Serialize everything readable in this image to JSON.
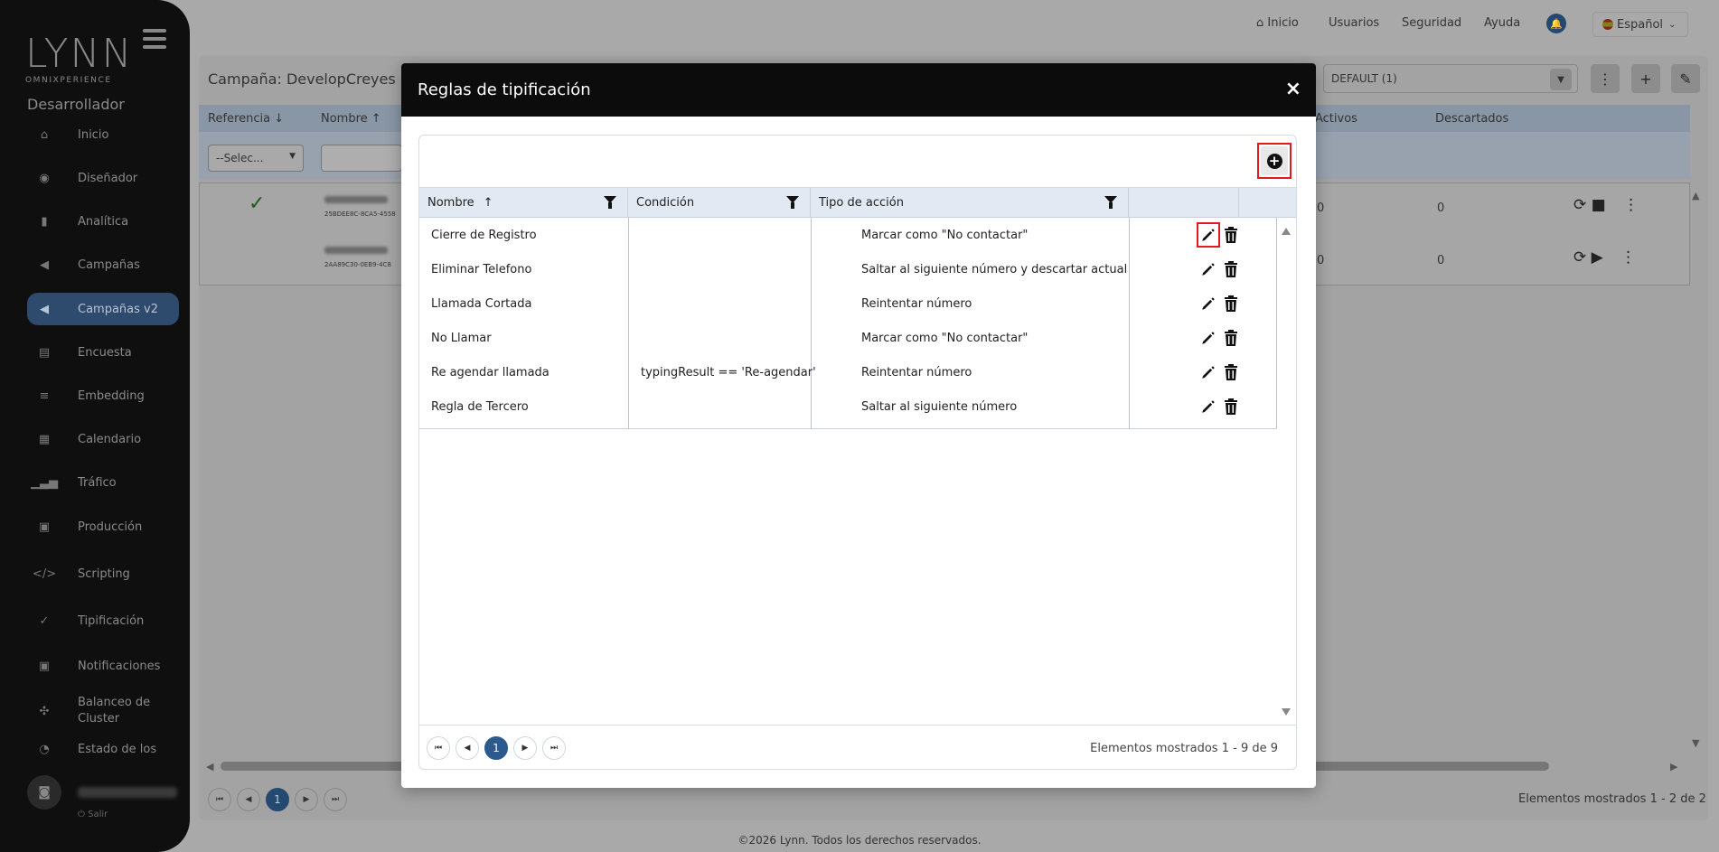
{
  "brand": {
    "logo_text": "LYNN",
    "logo_sub": "OMNIXPERIENCE"
  },
  "sidebar": {
    "role": "Desarrollador",
    "items": [
      {
        "label": "Inicio",
        "icon": "home-icon"
      },
      {
        "label": "Diseñador",
        "icon": "palette-icon"
      },
      {
        "label": "Analítica",
        "icon": "bar-chart-icon"
      },
      {
        "label": "Campañas",
        "icon": "megaphone-icon"
      },
      {
        "label": "Campañas v2",
        "icon": "megaphone-icon",
        "active": true
      },
      {
        "label": "Encuesta",
        "icon": "clipboard-icon"
      },
      {
        "label": "Embedding",
        "icon": "database-icon"
      },
      {
        "label": "Calendario",
        "icon": "calendar-icon"
      },
      {
        "label": "Tráfico",
        "icon": "signal-icon"
      },
      {
        "label": "Producción",
        "icon": "briefcase-icon"
      },
      {
        "label": "Scripting",
        "icon": "code-icon"
      },
      {
        "label": "Tipificación",
        "icon": "check-badge-icon"
      },
      {
        "label": "Notificaciones",
        "icon": "bell-square-icon"
      },
      {
        "label": "Balanceo de Cluster",
        "icon": "cluster-icon"
      },
      {
        "label": "Estado de los",
        "icon": "status-icon"
      }
    ],
    "logout": "Salir"
  },
  "topnav": {
    "home": "Inicio",
    "users": "Usuarios",
    "security": "Seguridad",
    "help": "Ayuda",
    "language": "Español"
  },
  "background": {
    "campaign_title": "Campaña: DevelopCreyes",
    "default_select": "DEFAULT (1)",
    "columns": [
      "Referencia",
      "Nombre",
      "Activos",
      "Descartados"
    ],
    "filter_select": "--Selec...",
    "rows": [
      {
        "id": "25BDEE8C-8CA5-4558",
        "activos": "0",
        "descartados": "0"
      },
      {
        "id": "2AA89C30-0EB9-4C8",
        "activos": "0",
        "descartados": "0"
      }
    ],
    "pager_current": "1",
    "count": "Elementos mostrados 1 - 2 de 2"
  },
  "modal": {
    "title": "Reglas de tipificación",
    "close": "×",
    "columns": {
      "nombre": "Nombre",
      "condicion": "Condición",
      "accion": "Tipo de acción"
    },
    "rows": [
      {
        "nombre": "Cierre de Registro",
        "condicion": "",
        "accion": "Marcar como \"No contactar\""
      },
      {
        "nombre": "Eliminar Telefono",
        "condicion": "",
        "accion": "Saltar al siguiente número y descartar actual"
      },
      {
        "nombre": "Llamada Cortada",
        "condicion": "",
        "accion": "Reintentar número"
      },
      {
        "nombre": "No Llamar",
        "condicion": "",
        "accion": "Marcar como \"No contactar\""
      },
      {
        "nombre": "Re agendar llamada",
        "condicion": "typingResult == 'Re-agendar'",
        "accion": "Reintentar número"
      },
      {
        "nombre": "Regla de Tercero",
        "condicion": "",
        "accion": "Saltar al siguiente número"
      }
    ],
    "pager_current": "1",
    "count": "Elementos mostrados 1 - 9 de 9"
  },
  "footer": "©2026 Lynn. Todos los derechos reservados.",
  "colors": {
    "accent": "#2c5a8c",
    "highlight": "#e01b1b",
    "header": "#0c0c0c"
  }
}
